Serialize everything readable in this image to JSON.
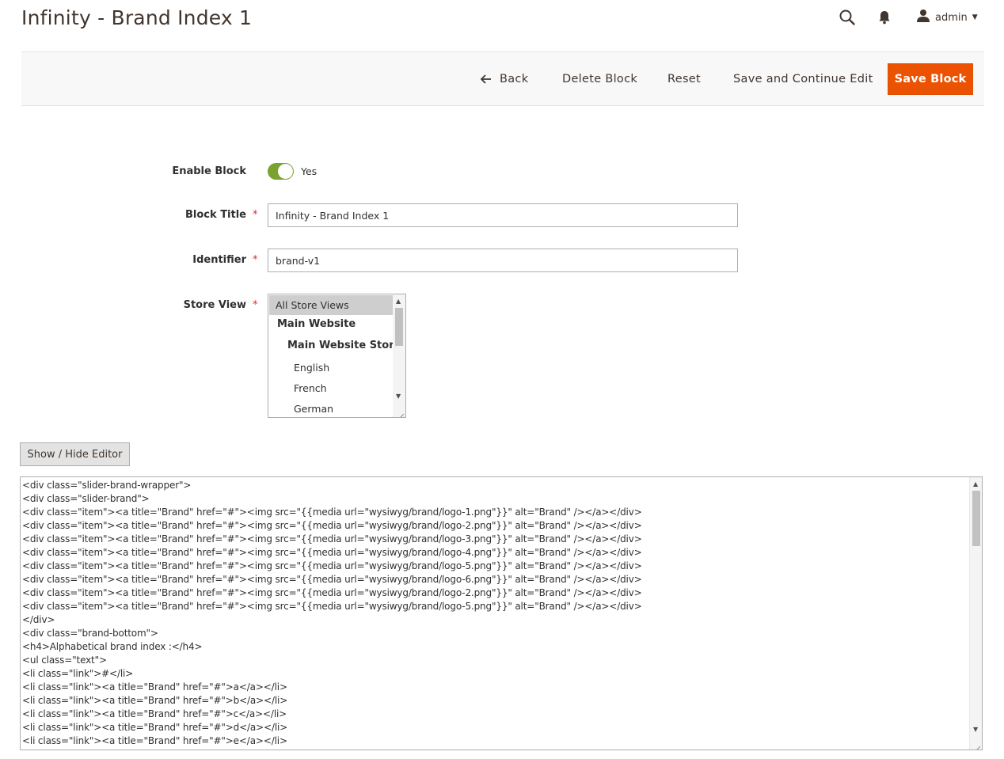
{
  "page": {
    "title": "Infinity - Brand Index 1"
  },
  "header": {
    "user_name": "admin"
  },
  "toolbar": {
    "back_label": "Back",
    "delete_label": "Delete Block",
    "reset_label": "Reset",
    "save_continue_label": "Save and Continue Edit",
    "save_label": "Save Block",
    "save_color": "#eb5202"
  },
  "form": {
    "enable_block": {
      "label": "Enable Block",
      "value_text": "Yes",
      "checked": true,
      "color": "#79a22e"
    },
    "block_title": {
      "label": "Block Title",
      "value": "Infinity - Brand Index 1"
    },
    "identifier": {
      "label": "Identifier",
      "value": "brand-v1"
    },
    "store_view": {
      "label": "Store View",
      "options": [
        "All Store Views",
        "Main Website",
        "Main Website Store",
        "English",
        "French",
        "German"
      ],
      "selected": "All Store Views"
    },
    "required_marker": "*"
  },
  "editor": {
    "toggle_label": "Show / Hide Editor",
    "lines": [
      "<div class=\"slider-brand-wrapper\">",
      "<div class=\"slider-brand\">",
      "<div class=\"item\"><a title=\"Brand\" href=\"#\"><img src=\"{{media url=\"wysiwyg/brand/logo-1.png\"}}\" alt=\"Brand\" /></a></div>",
      "<div class=\"item\"><a title=\"Brand\" href=\"#\"><img src=\"{{media url=\"wysiwyg/brand/logo-2.png\"}}\" alt=\"Brand\" /></a></div>",
      "<div class=\"item\"><a title=\"Brand\" href=\"#\"><img src=\"{{media url=\"wysiwyg/brand/logo-3.png\"}}\" alt=\"Brand\" /></a></div>",
      "<div class=\"item\"><a title=\"Brand\" href=\"#\"><img src=\"{{media url=\"wysiwyg/brand/logo-4.png\"}}\" alt=\"Brand\" /></a></div>",
      "<div class=\"item\"><a title=\"Brand\" href=\"#\"><img src=\"{{media url=\"wysiwyg/brand/logo-5.png\"}}\" alt=\"Brand\" /></a></div>",
      "<div class=\"item\"><a title=\"Brand\" href=\"#\"><img src=\"{{media url=\"wysiwyg/brand/logo-6.png\"}}\" alt=\"Brand\" /></a></div>",
      "<div class=\"item\"><a title=\"Brand\" href=\"#\"><img src=\"{{media url=\"wysiwyg/brand/logo-2.png\"}}\" alt=\"Brand\" /></a></div>",
      "<div class=\"item\"><a title=\"Brand\" href=\"#\"><img src=\"{{media url=\"wysiwyg/brand/logo-5.png\"}}\" alt=\"Brand\" /></a></div>",
      "</div>",
      "<div class=\"brand-bottom\">",
      "<h4>Alphabetical brand index :</h4>",
      "<ul class=\"text\">",
      "<li class=\"link\">#</li>",
      "<li class=\"link\"><a title=\"Brand\" href=\"#\">a</a></li>",
      "<li class=\"link\"><a title=\"Brand\" href=\"#\">b</a></li>",
      "<li class=\"link\"><a title=\"Brand\" href=\"#\">c</a></li>",
      "<li class=\"link\"><a title=\"Brand\" href=\"#\">d</a></li>",
      "<li class=\"link\"><a title=\"Brand\" href=\"#\">e</a></li>"
    ]
  },
  "icons": {
    "search": "search-icon",
    "notifications": "bell-icon",
    "user": "user-icon",
    "back": "arrow-left-icon"
  }
}
